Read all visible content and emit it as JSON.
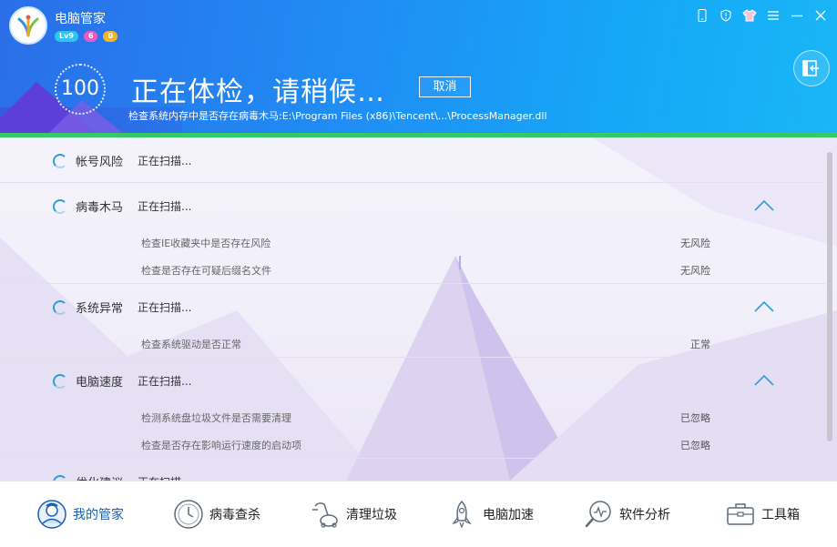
{
  "app": {
    "title": "电脑管家",
    "badges": {
      "level": "Lv9",
      "gift": "6",
      "coin": "0"
    }
  },
  "window_controls": [
    "phone-icon",
    "shield-icon",
    "shirt-icon",
    "menu-icon",
    "minimize-icon",
    "close-icon"
  ],
  "scan": {
    "score": "100",
    "headline": "正在体检，请稍候…",
    "cancel_label": "取消",
    "current_path": "检查系统内存中是否存在病毒木马:E:\\Program Files (x86)\\Tencent\\...\\ProcessManager.dll",
    "progress_fraction": 1.0
  },
  "categories": [
    {
      "name": "帐号风险",
      "status": "正在扫描...",
      "expanded": false,
      "items": []
    },
    {
      "name": "病毒木马",
      "status": "正在扫描...",
      "expanded": true,
      "items": [
        {
          "label": "检查IE收藏夹中是否存在风险",
          "result": "无风险"
        },
        {
          "label": "检查是否存在可疑后缀名文件",
          "result": "无风险"
        }
      ]
    },
    {
      "name": "系统异常",
      "status": "正在扫描...",
      "expanded": true,
      "items": [
        {
          "label": "检查系统驱动是否正常",
          "result": "正常"
        }
      ]
    },
    {
      "name": "电脑速度",
      "status": "正在扫描...",
      "expanded": true,
      "items": [
        {
          "label": "检测系统盘垃圾文件是否需要清理",
          "result": "已忽略"
        },
        {
          "label": "检查是否存在影响运行速度的启动项",
          "result": "已忽略"
        }
      ]
    },
    {
      "name": "优化建议",
      "status": "正在扫描...",
      "expanded": false,
      "items": []
    }
  ],
  "nav": [
    {
      "label": "我的管家",
      "icon": "butler-icon",
      "active": true
    },
    {
      "label": "病毒查杀",
      "icon": "clock-scan-icon",
      "active": false
    },
    {
      "label": "清理垃圾",
      "icon": "vacuum-icon",
      "active": false
    },
    {
      "label": "电脑加速",
      "icon": "rocket-icon",
      "active": false
    },
    {
      "label": "软件分析",
      "icon": "analysis-icon",
      "active": false
    },
    {
      "label": "工具箱",
      "icon": "toolbox-icon",
      "active": false
    }
  ],
  "colors": {
    "header_start": "#2b6ee8",
    "header_end": "#1ab6f5",
    "progress": "#36c96a",
    "accent": "#2d9ed8"
  }
}
